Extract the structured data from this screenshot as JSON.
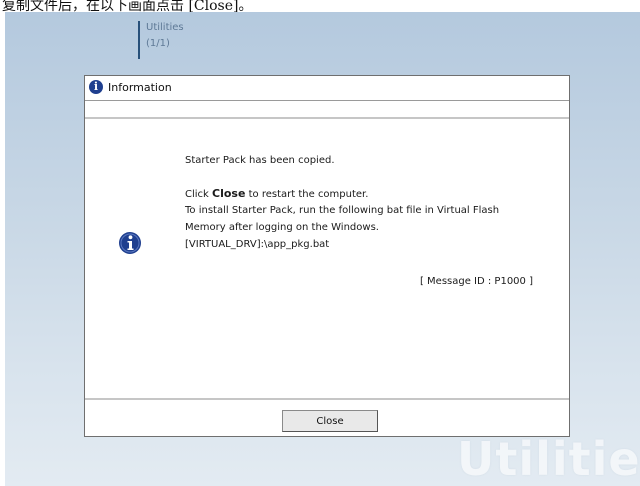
{
  "caption": "复制文件后，在以下画面点击 [Close]。",
  "header": {
    "title": "Utilities",
    "page_count": "(1/1)"
  },
  "watermark": "Utilities",
  "dialog": {
    "title": "Information",
    "message_line1": "Starter Pack has been copied.",
    "message_click_prefix": "Click ",
    "message_click_bold": "Close",
    "message_click_suffix": " to restart the computer.",
    "message_line3": "To install Starter Pack, run the following bat file in Virtual Flash",
    "message_line4": "Memory after logging on the Windows.",
    "message_line5": "[VIRTUAL_DRV]:\\app_pkg.bat",
    "message_id": "[ Message ID : P1000 ]",
    "close_label": "Close"
  },
  "colors": {
    "icon_blue": "#1f3f8f",
    "accent_bar": "#27507a",
    "background_top": "#b4c9de"
  },
  "icons": {
    "title": "info-icon",
    "body": "info-icon"
  }
}
